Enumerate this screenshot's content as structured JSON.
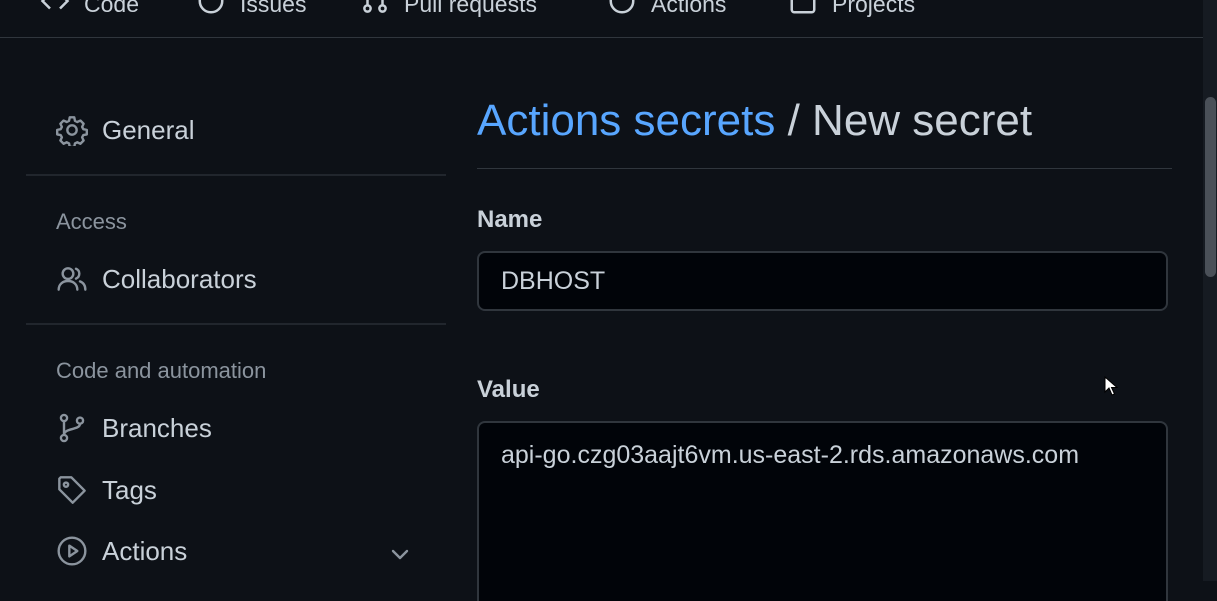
{
  "topnav": {
    "tabs": [
      {
        "label": "Code",
        "icon": "code-icon"
      },
      {
        "label": "Issues",
        "icon": "issue-icon"
      },
      {
        "label": "Pull requests",
        "icon": "pull-request-icon"
      },
      {
        "label": "Actions",
        "icon": "play-icon"
      },
      {
        "label": "Projects",
        "icon": "project-icon"
      }
    ]
  },
  "sidebar": {
    "general": {
      "label": "General",
      "icon": "gear-icon"
    },
    "sections": [
      {
        "label": "Access",
        "items": [
          {
            "label": "Collaborators",
            "icon": "people-icon"
          }
        ]
      },
      {
        "label": "Code and automation",
        "items": [
          {
            "label": "Branches",
            "icon": "branch-icon"
          },
          {
            "label": "Tags",
            "icon": "tag-icon"
          },
          {
            "label": "Actions",
            "icon": "play-icon",
            "expandable": true
          }
        ]
      }
    ]
  },
  "main": {
    "breadcrumb_link": "Actions secrets",
    "separator": "/",
    "current": "New secret",
    "name_label": "Name",
    "name_value": "DBHOST",
    "value_label": "Value",
    "value_text": "api-go.czg03aajt6vm.us-east-2.rds.amazonaws.com"
  },
  "colors": {
    "background": "#0d1117",
    "link": "#58a6ff",
    "text": "#c9d1d9",
    "muted": "#8b949e"
  }
}
